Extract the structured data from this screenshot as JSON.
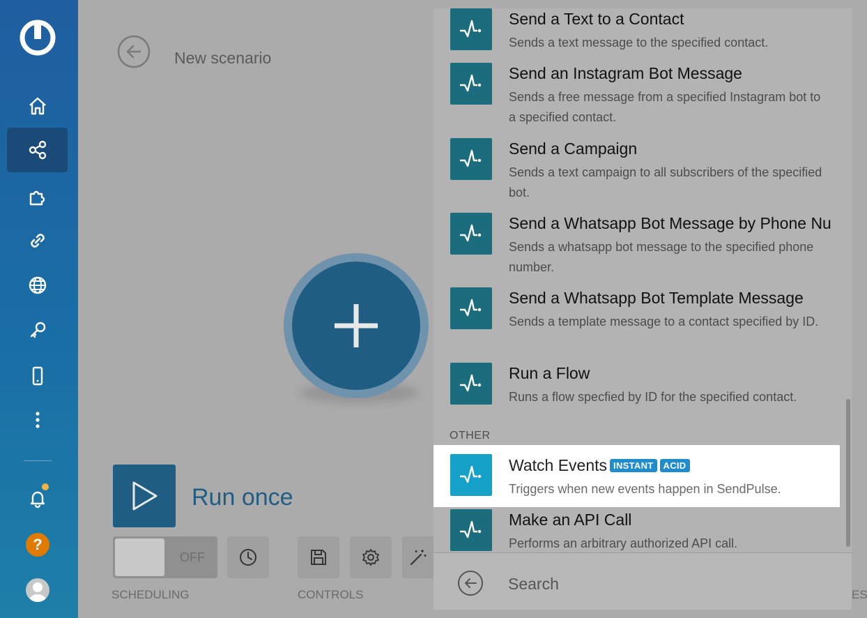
{
  "sidebar": {
    "nav": [
      "home",
      "scenarios",
      "templates",
      "connections",
      "webhooks",
      "keys",
      "devices",
      "more"
    ],
    "active": "scenarios",
    "help_label": "?"
  },
  "header": {
    "title": "New scenario"
  },
  "canvas": {
    "run_once_label": "Run once"
  },
  "toolbar": {
    "scheduling_label": "SCHEDULING",
    "scheduling_state": "OFF",
    "controls_label": "CONTROLS",
    "right_edge_fragment": "ES"
  },
  "panel": {
    "items": [
      {
        "title": "Send a Text to a Contact",
        "desc": "Sends a text message to the specified contact."
      },
      {
        "title": "Send an Instagram Bot Message",
        "desc": "Sends a free message from a specified Instagram bot to a specified contact."
      },
      {
        "title": "Send a Campaign",
        "desc": "Sends a text campaign to all subscribers of the specified bot."
      },
      {
        "title": "Send a Whatsapp Bot Message by Phone Number",
        "desc": "Sends a whatsapp bot message to the specified phone number."
      },
      {
        "title": "Send a Whatsapp Bot Template Message",
        "desc": "Sends a template message to a contact specified by ID."
      },
      {
        "title": "Run a Flow",
        "desc": "Runs a flow specfied by ID for the specified contact."
      }
    ],
    "section_other": "OTHER",
    "selected": {
      "title": "Watch Events",
      "badge_instant": "INSTANT",
      "badge_acid": "ACID",
      "desc": "Triggers when new events happen in SendPulse."
    },
    "last_item": {
      "title": "Make an API Call",
      "desc": "Performs an arbitrary authorized API call."
    },
    "search_label": "Search"
  },
  "colors": {
    "sidebar": "#1f5ea0",
    "module": "#1f5e82",
    "item_icon": "#1b6d7d",
    "selected_icon": "#16a1c8",
    "badge": "#1f8ccd",
    "notification": "#f2b241",
    "help": "#e07a00"
  }
}
